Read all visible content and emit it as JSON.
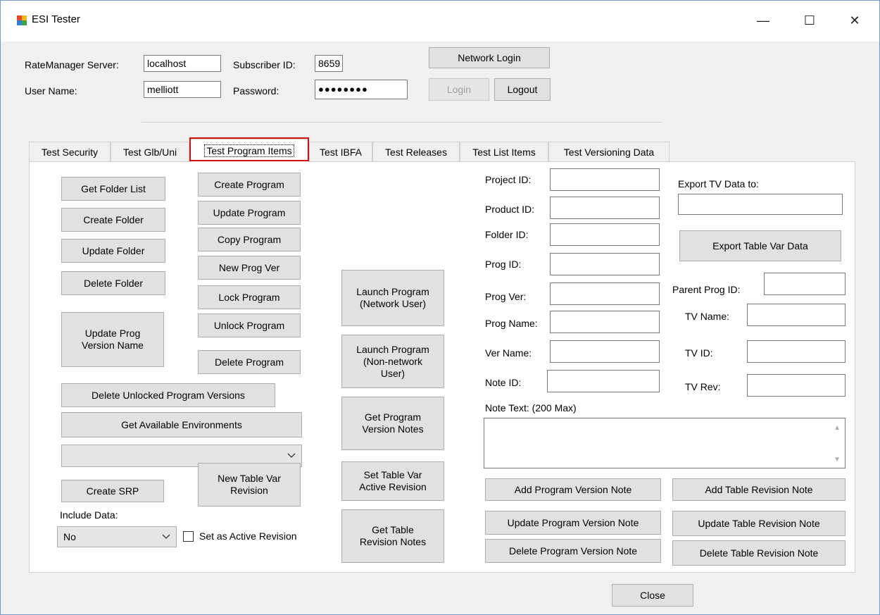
{
  "window": {
    "title": "ESI Tester",
    "minimize_glyph": "—",
    "maximize_glyph": "☐",
    "close_glyph": "✕"
  },
  "login": {
    "server_label": "RateManager Server:",
    "server_value": "localhost",
    "subscriber_label": "Subscriber ID:",
    "subscriber_value": "8659",
    "network_login_button": "Network Login",
    "user_label": "User Name:",
    "user_value": "melliott",
    "password_label": "Password:",
    "password_value": "●●●●●●●●",
    "login_button": "Login",
    "logout_button": "Logout"
  },
  "tabs": [
    {
      "label": "Test Security"
    },
    {
      "label": "Test Glb/Uni"
    },
    {
      "label": "Test Program Items",
      "active": true
    },
    {
      "label": "Test IBFA"
    },
    {
      "label": "Test Releases"
    },
    {
      "label": "Test List Items"
    },
    {
      "label": "Test Versioning Data"
    }
  ],
  "folder_buttons": {
    "get_folder_list": "Get Folder List",
    "create_folder": "Create Folder",
    "update_folder": "Update Folder",
    "delete_folder": "Delete Folder",
    "update_prog_version_name": "Update Prog Version Name",
    "delete_unlocked_versions": "Delete Unlocked Program Versions",
    "get_available_environments": "Get Available Environments"
  },
  "environment_combo": {
    "value": ""
  },
  "srp": {
    "create_srp": "Create SRP",
    "include_data_label": "Include Data:",
    "include_data_value": "No",
    "new_table_var_revision": "New Table Var Revision",
    "set_active_label": "Set as Active Revision"
  },
  "program_buttons": {
    "create_program": "Create Program",
    "update_program": "Update Program",
    "copy_program": "Copy Program",
    "new_prog_ver": "New Prog Ver",
    "lock_program": "Lock Program",
    "unlock_program": "Unlock Program",
    "delete_program": "Delete Program"
  },
  "launch_buttons": {
    "launch_network": "Launch Program (Network User)",
    "launch_non_network": "Launch Program (Non-network User)",
    "get_version_notes": "Get Program Version Notes",
    "set_active_revision": "Set Table Var Active Revision",
    "get_table_revision_notes": "Get Table Revision Notes"
  },
  "fields": {
    "project_id": "Project ID:",
    "product_id": "Product ID:",
    "folder_id": "Folder ID:",
    "prog_id": "Prog ID:",
    "prog_ver": "Prog Ver:",
    "prog_name": "Prog Name:",
    "ver_name": "Ver Name:",
    "note_id": "Note ID:",
    "note_text": "Note Text: (200 Max)"
  },
  "export": {
    "label": "Export TV Data to:",
    "button": "Export Table Var Data"
  },
  "tv_fields": {
    "parent_prog_id": "Parent Prog ID:",
    "tv_name": "TV Name:",
    "tv_id": "TV ID:",
    "tv_rev": "TV Rev:"
  },
  "note_buttons": {
    "add_prog_note": "Add Program Version Note",
    "update_prog_note": "Update Program Version Note",
    "delete_prog_note": "Delete Program Version Note",
    "add_table_note": "Add Table Revision Note",
    "update_table_note": "Update Table Revision Note",
    "delete_table_note": "Delete Table Revision Note"
  },
  "footer": {
    "close_button": "Close"
  }
}
